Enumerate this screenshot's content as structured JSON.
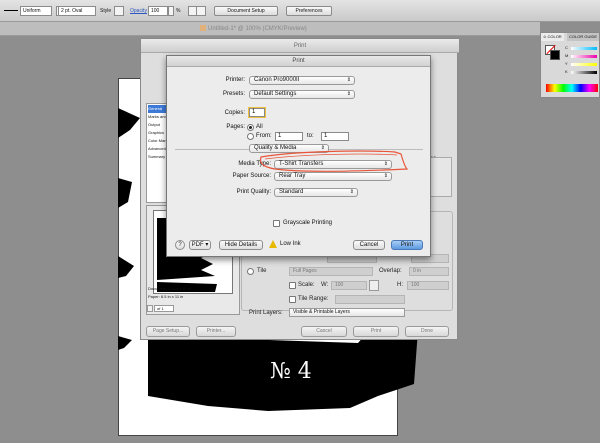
{
  "control_bar": {
    "stroke_profile": "Uniform",
    "brush": "2 pt. Oval",
    "style_label": "Style",
    "opacity_label": "Opacity",
    "opacity_value": "100",
    "percent_sign": "%",
    "document_setup_label": "Document Setup",
    "preferences_label": "Preferences"
  },
  "document": {
    "title": "Untitled-1* @ 100% (CMYK/Preview)",
    "number_mark": "№ 4"
  },
  "color_panel": {
    "tabs": [
      "≎ COLOR",
      "COLOR GUIDE"
    ],
    "channels": [
      "C",
      "M",
      "Y",
      "K"
    ]
  },
  "print_back": {
    "title": "Print",
    "sidebar_items": [
      "General",
      "Marks and",
      "Output",
      "Graphics",
      "Color Mana",
      "Advanced",
      "Summary"
    ],
    "document_size": "Document: 8.5 in x 11 in",
    "paper_size": "Paper: 8.5 in x 11 in",
    "page_nav": "of 1",
    "right_fragment_1": "se",
    "tile_label": "Tile",
    "tile_value": "Full Pages",
    "overlap_label": "Overlap:",
    "overlap_value": "0 in",
    "w_label": "W:",
    "w_value": "100",
    "h_label": "H:",
    "h_value": "100",
    "scale_label": "Scale:",
    "tile_range_label": "Tile Range:",
    "print_layers_label": "Print Layers:",
    "print_layers_value": "Visible & Printable Layers",
    "page_setup_label": "Page Setup...",
    "printer_button_label": "Printer...",
    "cancel_label": "Cancel",
    "print_label": "Print",
    "done_label": "Done"
  },
  "print_sheet": {
    "title": "Print",
    "printer_label": "Printer:",
    "printer_value": "Canon Pro9000II",
    "presets_label": "Presets:",
    "presets_value": "Default Settings",
    "copies_label": "Copies:",
    "copies_value": "1",
    "pages_label": "Pages:",
    "all_label": "All",
    "from_label": "From:",
    "from_value": "1",
    "to_label": "to:",
    "to_value": "1",
    "panel_value": "Quality & Media",
    "media_type_label": "Media Type:",
    "media_type_value": "T-Shirt Transfers",
    "paper_source_label": "Paper Source:",
    "paper_source_value": "Rear Tray",
    "print_quality_label": "Print Quality:",
    "print_quality_value": "Standard",
    "grayscale_label": "Grayscale Printing",
    "help_label": "?",
    "pdf_label": "PDF ▾",
    "hide_details_label": "Hide Details",
    "low_ink_label": "Low Ink",
    "cancel_label": "Cancel",
    "print_label": "Print"
  },
  "colors": {
    "highlight_stroke": "#e8553a",
    "primary_button": "#5d9ae0"
  }
}
